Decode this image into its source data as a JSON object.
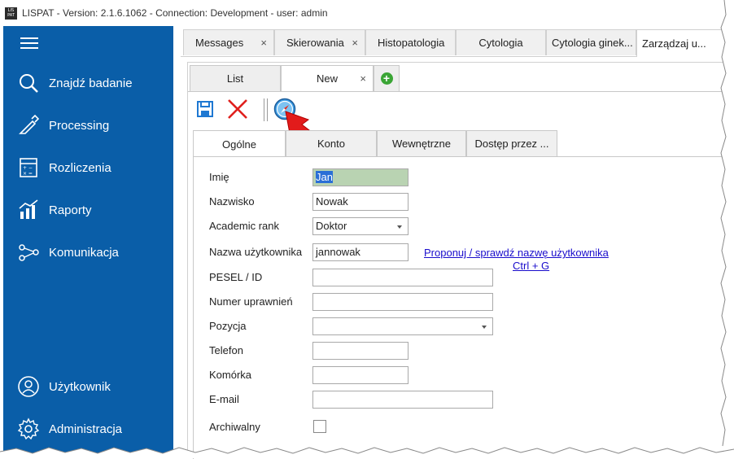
{
  "window": {
    "title": "LISPAT - Version: 2.1.6.1062 - Connection: Development - user: admin",
    "logo_text": "LIS PAT"
  },
  "sidebar": {
    "items": [
      {
        "label": "Znajdź badanie",
        "icon": "search-icon"
      },
      {
        "label": "Processing",
        "icon": "pipette-icon"
      },
      {
        "label": "Rozliczenia",
        "icon": "calculator-icon"
      },
      {
        "label": "Raporty",
        "icon": "chart-icon"
      },
      {
        "label": "Komunikacja",
        "icon": "share-icon"
      },
      {
        "label": "Użytkownik",
        "icon": "user-icon"
      },
      {
        "label": "Administracja",
        "icon": "gear-icon"
      }
    ],
    "color": "#0a5ea8"
  },
  "top_tabs": [
    {
      "label": "Messages",
      "closable": true
    },
    {
      "label": "Skierowania",
      "closable": true
    },
    {
      "label": "Histopatologia",
      "closable": false
    },
    {
      "label": "Cytologia",
      "closable": false
    },
    {
      "label": "Cytologia ginek...",
      "closable": false
    },
    {
      "label": "Zarządzaj u...",
      "closable": false,
      "active": true
    }
  ],
  "sub_tabs": [
    {
      "label": "List"
    },
    {
      "label": "New",
      "active": true,
      "closable": true
    }
  ],
  "form_tabs": [
    {
      "label": "Ogólne",
      "active": true
    },
    {
      "label": "Konto"
    },
    {
      "label": "Wewnętrzne"
    },
    {
      "label": "Dostęp przez ..."
    }
  ],
  "form": {
    "imie_label": "Imię",
    "imie_value": "Jan",
    "nazwisko_label": "Nazwisko",
    "nazwisko_value": "Nowak",
    "rank_label": "Academic rank",
    "rank_value": "Doktor",
    "username_label": "Nazwa użytkownika",
    "username_value": "jannowak",
    "suggest_link": "Proponuj / sprawdź nazwę użytkownika",
    "suggest_shortcut": "Ctrl + G",
    "pesel_label": "PESEL / ID",
    "pesel_value": "",
    "numer_label": "Numer uprawnień",
    "numer_value": "",
    "pozycja_label": "Pozycja",
    "pozycja_value": "",
    "telefon_label": "Telefon",
    "telefon_value": "",
    "komorka_label": "Komórka",
    "komorka_value": "",
    "email_label": "E-mail",
    "email_value": "",
    "archiwalny_label": "Archiwalny"
  }
}
